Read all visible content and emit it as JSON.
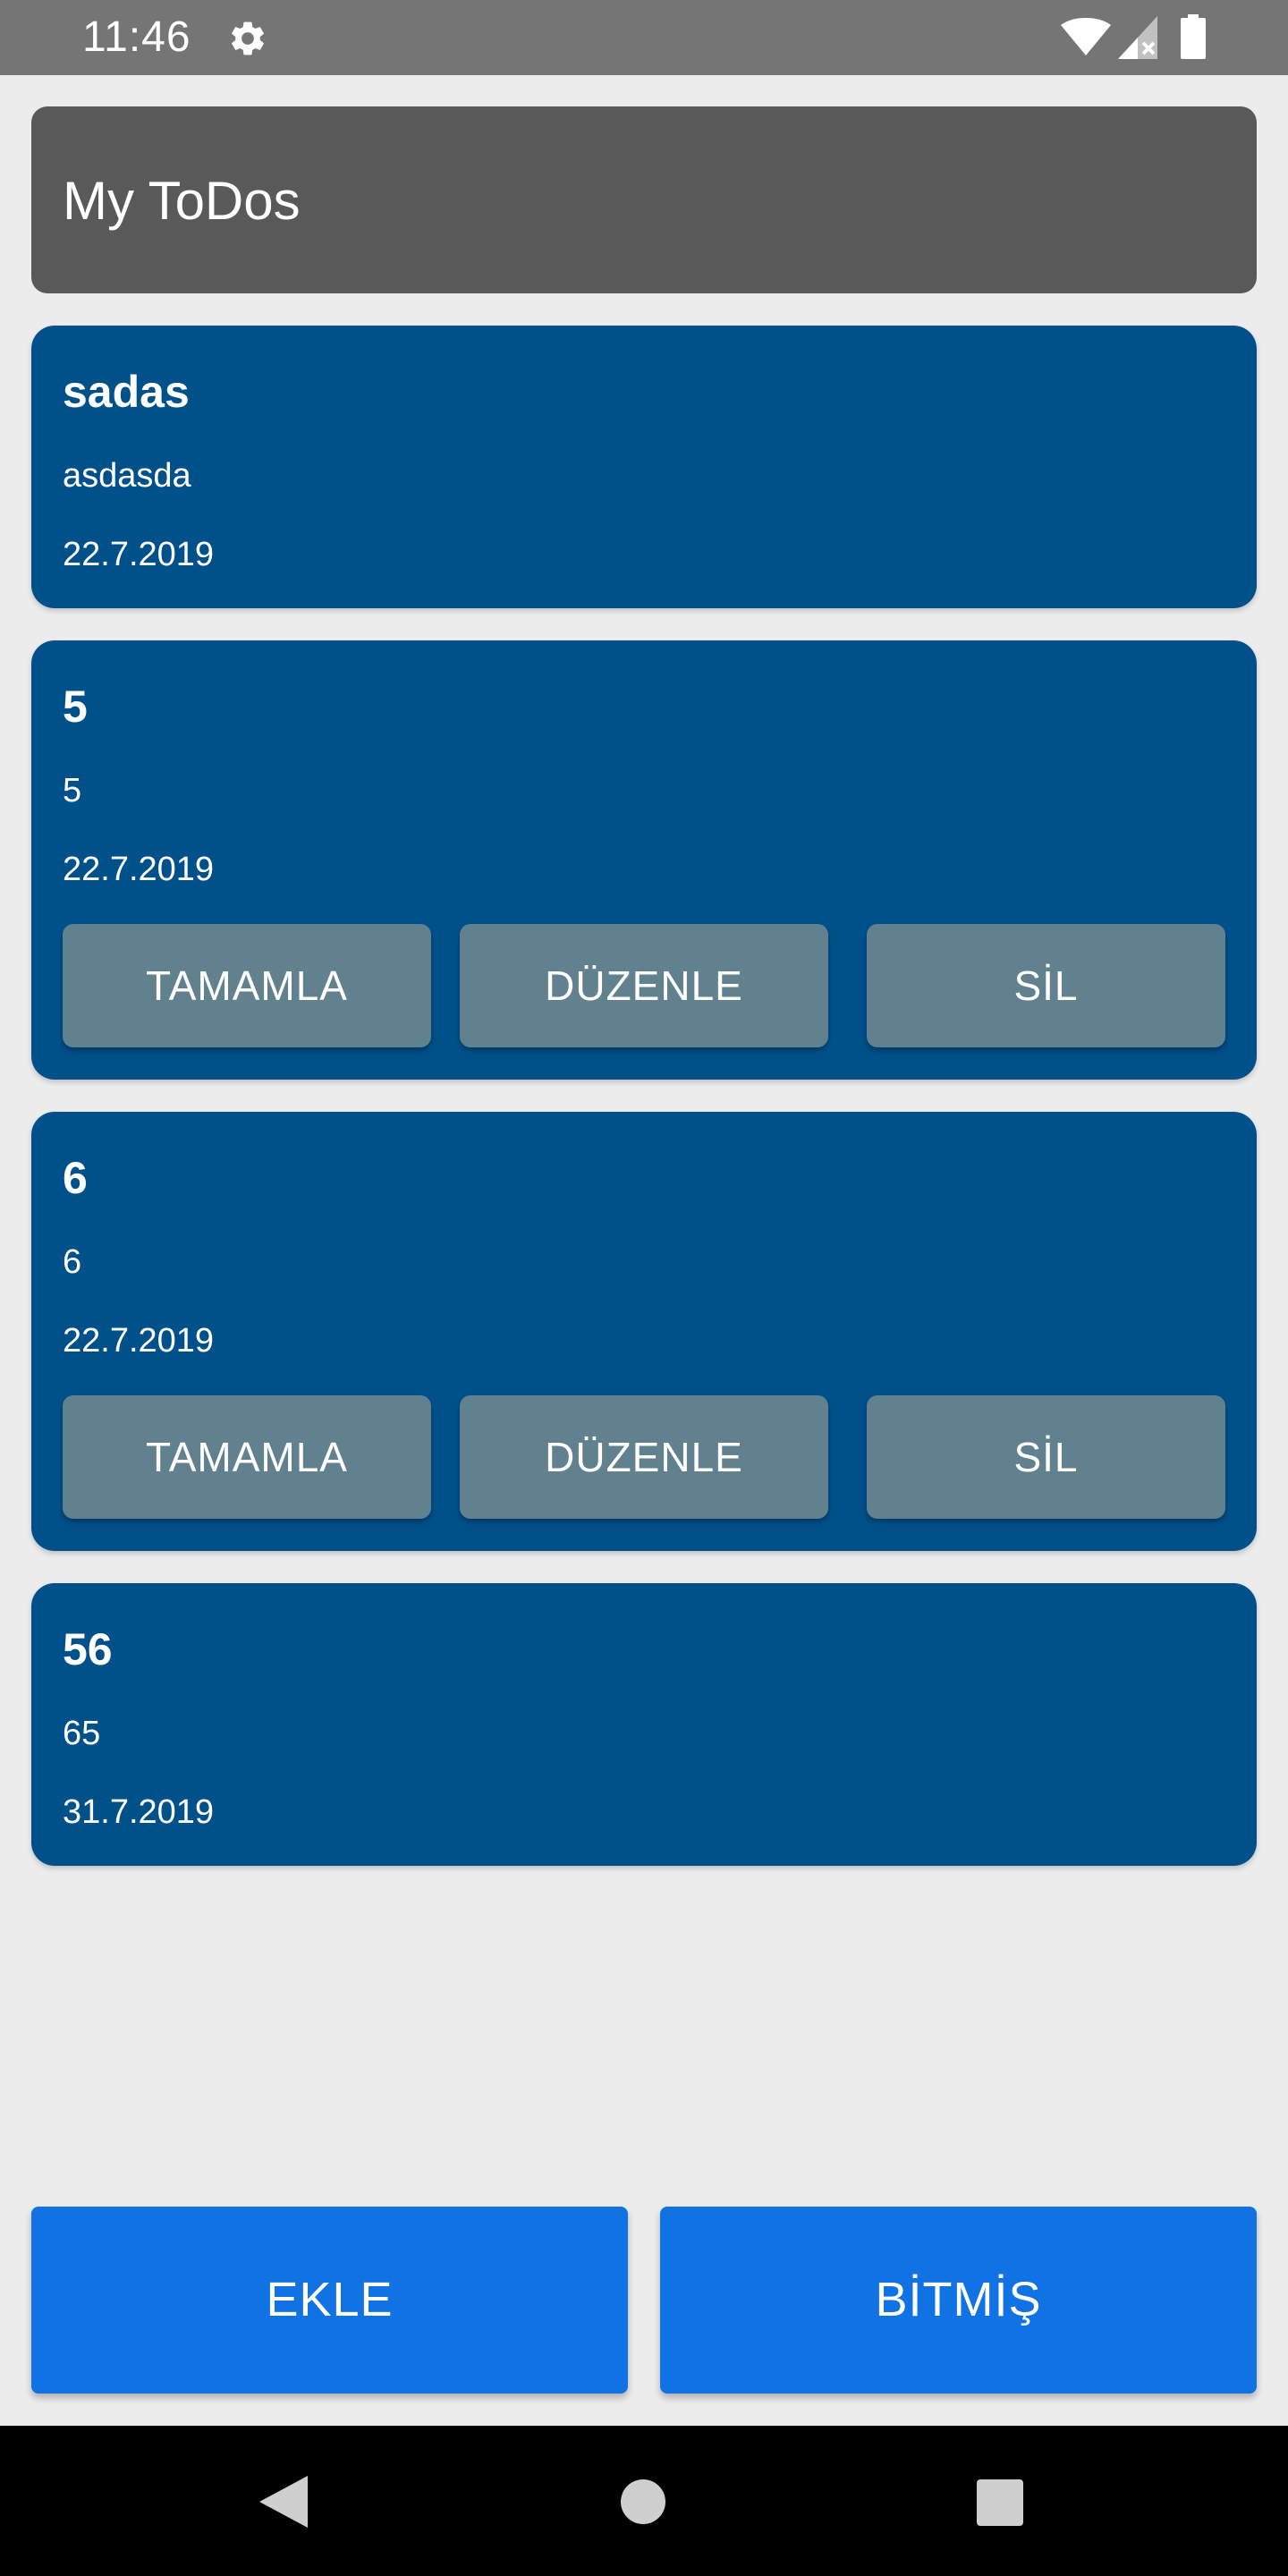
{
  "status_bar": {
    "time": "11:46",
    "icons": [
      "gear-icon",
      "wifi-icon",
      "signal-icon",
      "battery-icon"
    ]
  },
  "header": {
    "title": "My ToDos"
  },
  "todos": [
    {
      "title": "sadas",
      "description": "asdasda",
      "date": "22.7.2019",
      "show_actions": false
    },
    {
      "title": "5",
      "description": "5",
      "date": "22.7.2019",
      "show_actions": true
    },
    {
      "title": "6",
      "description": "6",
      "date": "22.7.2019",
      "show_actions": true
    },
    {
      "title": "56",
      "description": "65",
      "date": "31.7.2019",
      "show_actions": false
    }
  ],
  "card_actions": {
    "complete_label": "TAMAMLA",
    "edit_label": "DÜZENLE",
    "delete_label": "SİL"
  },
  "bottom_actions": {
    "add_label": "EKLE",
    "finished_label": "BİTMİŞ"
  },
  "nav_bar": {
    "icons": [
      "back-icon",
      "home-icon",
      "recents-icon"
    ]
  },
  "colors": {
    "status_bar": "#757575",
    "header": "#595959",
    "card": "#00508a",
    "card_button": "#61818f",
    "primary_button": "#1172e3",
    "background": "#ececec",
    "nav_bar": "#000000"
  }
}
